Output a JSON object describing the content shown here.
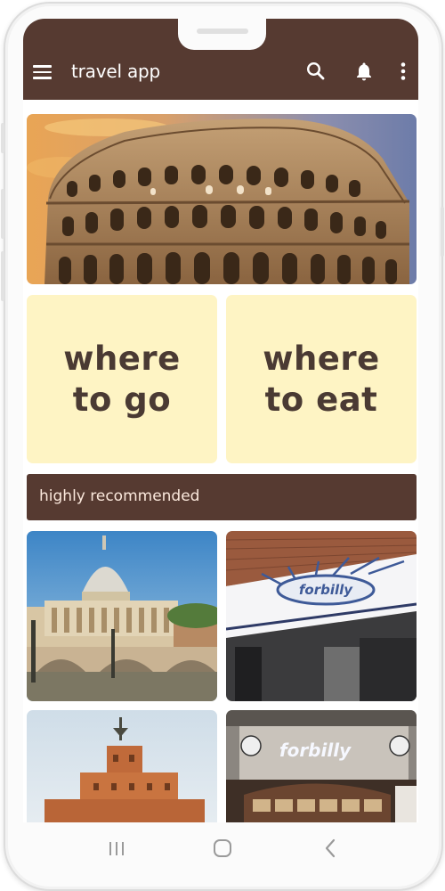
{
  "app": {
    "title": "travel app"
  },
  "toolbar": {
    "menu_icon": "hamburger-menu-icon",
    "search_icon": "search-icon",
    "notifications_icon": "bell-icon",
    "more_icon": "more-vertical-icon"
  },
  "banner": {
    "image": "colosseum-photo"
  },
  "categories": [
    {
      "label_line1": "where",
      "label_line2": "to go"
    },
    {
      "label_line1": "where",
      "label_line2": "to eat"
    }
  ],
  "section": {
    "title": "highly recommended"
  },
  "recommended": [
    {
      "image": "st-peters-basilica-photo"
    },
    {
      "image": "forbilly-restaurant-photo"
    },
    {
      "image": "castel-sant-angelo-photo"
    },
    {
      "image": "food-shop-photo"
    }
  ],
  "system_nav": {
    "recents_icon": "recents-icon",
    "home_icon": "home-icon",
    "back_icon": "back-icon"
  },
  "colors": {
    "primary": "#563a31",
    "card": "#fef4c4",
    "card_text": "#4a3a33",
    "section_text": "#fbe8dc"
  }
}
